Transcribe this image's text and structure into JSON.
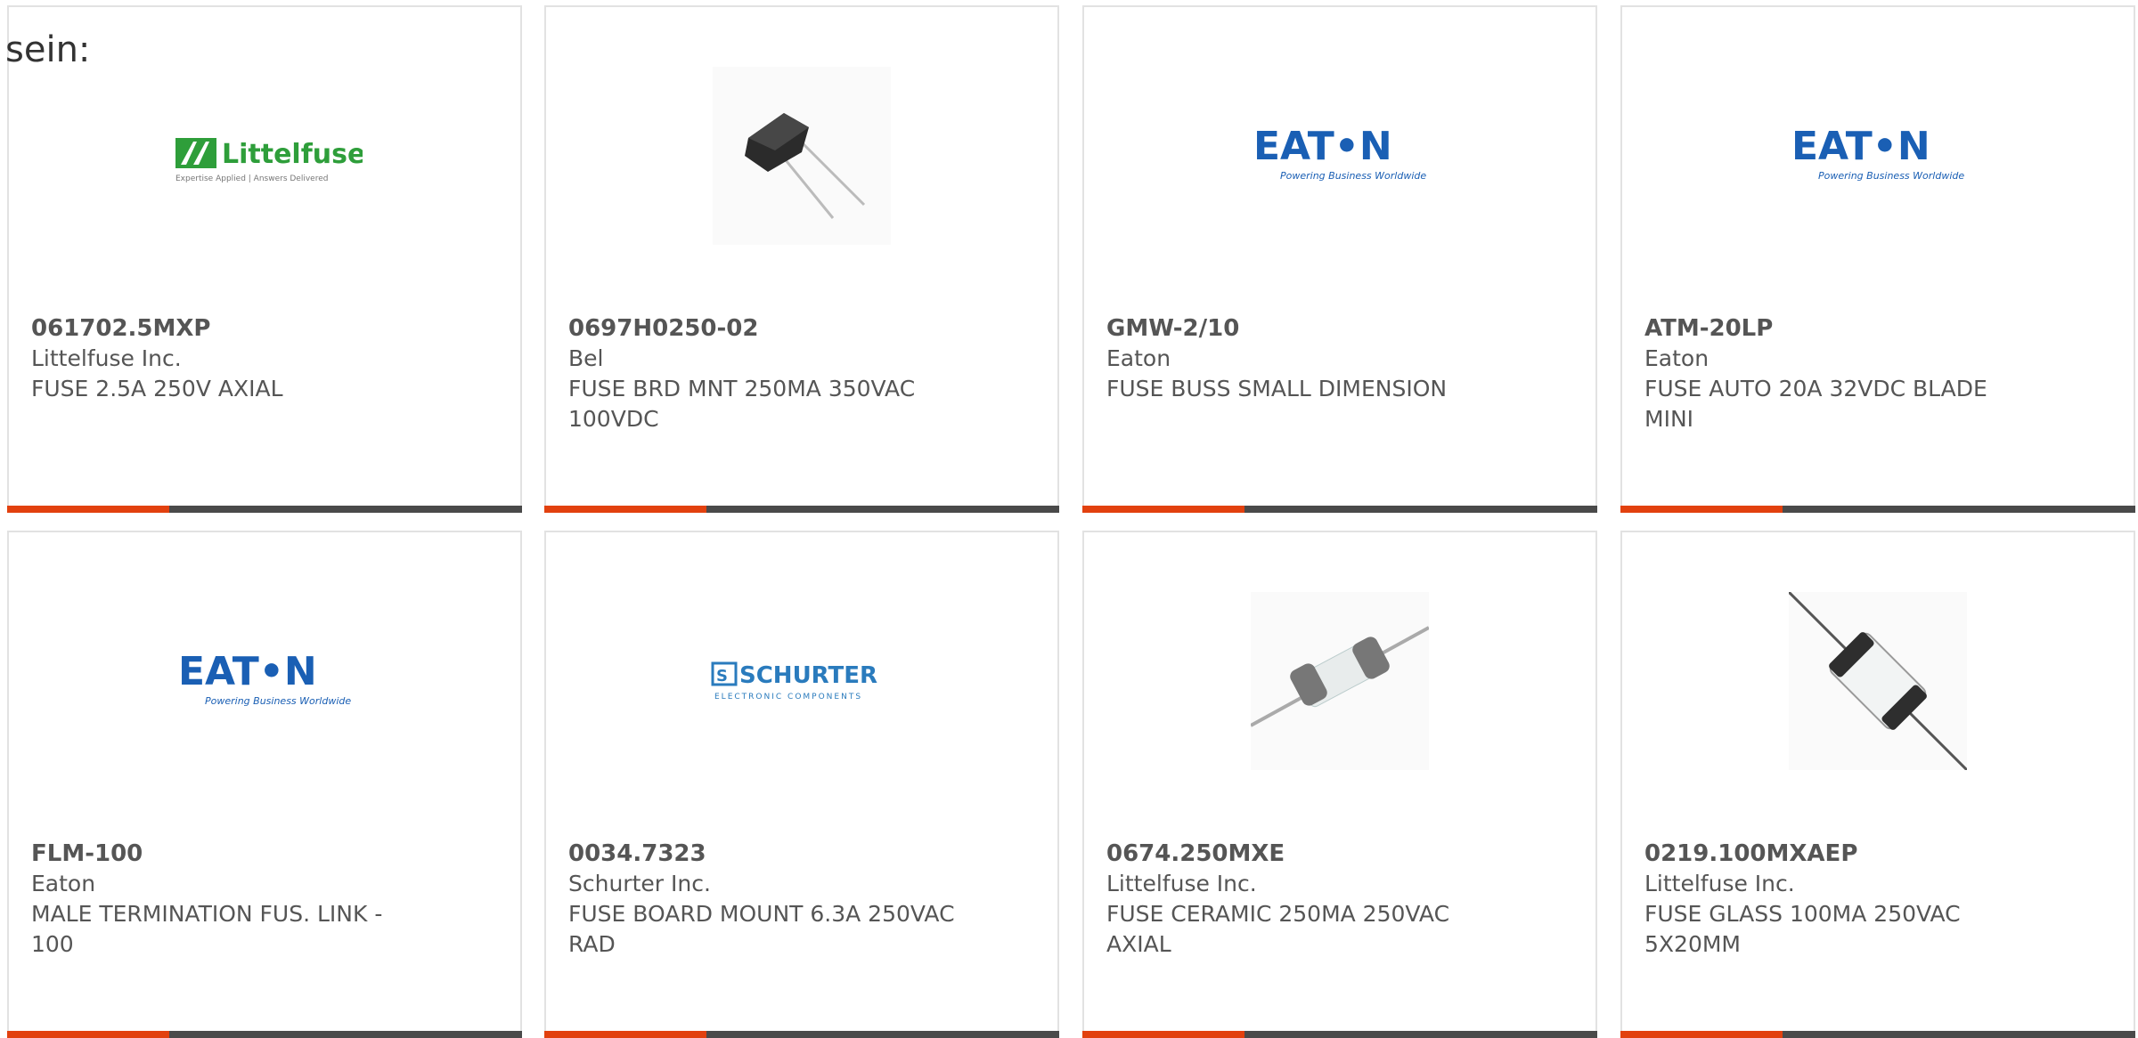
{
  "intro_text": "sein:",
  "colors": {
    "accent": "#e2410f",
    "bar": "#4a4a4a",
    "eaton_blue": "#1a5fb4",
    "littelfuse_green": "#2e9e3a",
    "schurter_blue": "#2a7bbd"
  },
  "products": [
    {
      "part_number": "061702.5MXP",
      "manufacturer": "Littelfuse Inc.",
      "description": "FUSE 2.5A 250V AXIAL",
      "image": "littelfuse-logo"
    },
    {
      "part_number": "0697H0250-02",
      "manufacturer": "Bel",
      "description": "FUSE BRD MNT 250MA 350VAC 100VDC",
      "image": "radial-fuse-photo"
    },
    {
      "part_number": "GMW-2/10",
      "manufacturer": "Eaton",
      "description": "FUSE BUSS SMALL DIMENSION",
      "image": "eaton-logo"
    },
    {
      "part_number": "ATM-20LP",
      "manufacturer": "Eaton",
      "description": "FUSE AUTO 20A 32VDC BLADE MINI",
      "image": "eaton-logo"
    },
    {
      "part_number": "FLM-100",
      "manufacturer": "Eaton",
      "description": "MALE TERMINATION FUS. LINK - 100",
      "image": "eaton-logo"
    },
    {
      "part_number": "0034.7323",
      "manufacturer": "Schurter Inc.",
      "description": "FUSE BOARD MOUNT 6.3A 250VAC RAD",
      "image": "schurter-logo"
    },
    {
      "part_number": "0674.250MXE",
      "manufacturer": "Littelfuse Inc.",
      "description": "FUSE CERAMIC 250MA 250VAC AXIAL",
      "image": "ceramic-fuse-photo"
    },
    {
      "part_number": "0219.100MXAEP",
      "manufacturer": "Littelfuse Inc.",
      "description": "FUSE GLASS 100MA 250VAC 5X20MM",
      "image": "glass-fuse-photo"
    }
  ],
  "logos": {
    "littelfuse_name": "Littelfuse",
    "littelfuse_tagline": "Expertise Applied | Answers Delivered",
    "eaton_name": "EAT•N",
    "eaton_tagline": "Powering Business Worldwide",
    "schurter_name": "SCHURTER",
    "schurter_tagline": "ELECTRONIC COMPONENTS"
  }
}
